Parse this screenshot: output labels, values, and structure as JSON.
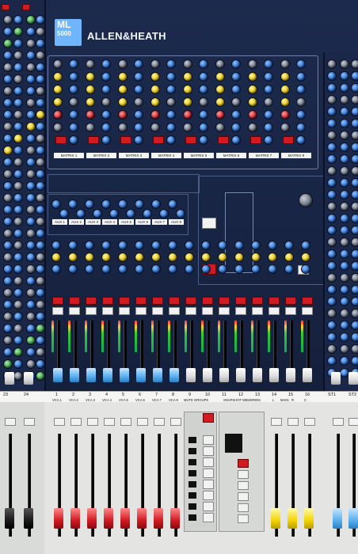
{
  "brand": {
    "model_line1": "ML",
    "model_line2": "5000",
    "name": "ALLEN&HEATH"
  },
  "matrix_labels": [
    "MATRIX 1",
    "MATRIX 2",
    "MATRIX 3",
    "MATRIX 4",
    "MATRIX 5",
    "MATRIX 6",
    "MATRIX 7",
    "MATRIX 8"
  ],
  "aux_labels": [
    "AUX 1",
    "AUX 2",
    "AUX 3",
    "AUX 4",
    "AUX 5",
    "AUX 6",
    "AUX 7",
    "AUX 8"
  ],
  "left_channels": [
    "23",
    "24"
  ],
  "group_numbers": [
    "1",
    "2",
    "3",
    "4",
    "5",
    "6",
    "7",
    "8",
    "9",
    "10",
    "11",
    "12",
    "13",
    "14",
    "15",
    "16"
  ],
  "vca_labels": [
    "VCA 1",
    "VCA 2",
    "VCA 3",
    "VCA 4",
    "VCA 5",
    "VCA 6",
    "VCA 7",
    "VCA 8"
  ],
  "section_labels": {
    "mute_groups": "MUTE GROUPS",
    "snapshot": "SNAPSHOT MEMORIES"
  },
  "main_labels": {
    "l": "L",
    "main": "MAIN",
    "r": "R",
    "c": "C"
  },
  "stereo_labels": [
    "ST1",
    "ST2"
  ],
  "mute_label": "MUTE"
}
